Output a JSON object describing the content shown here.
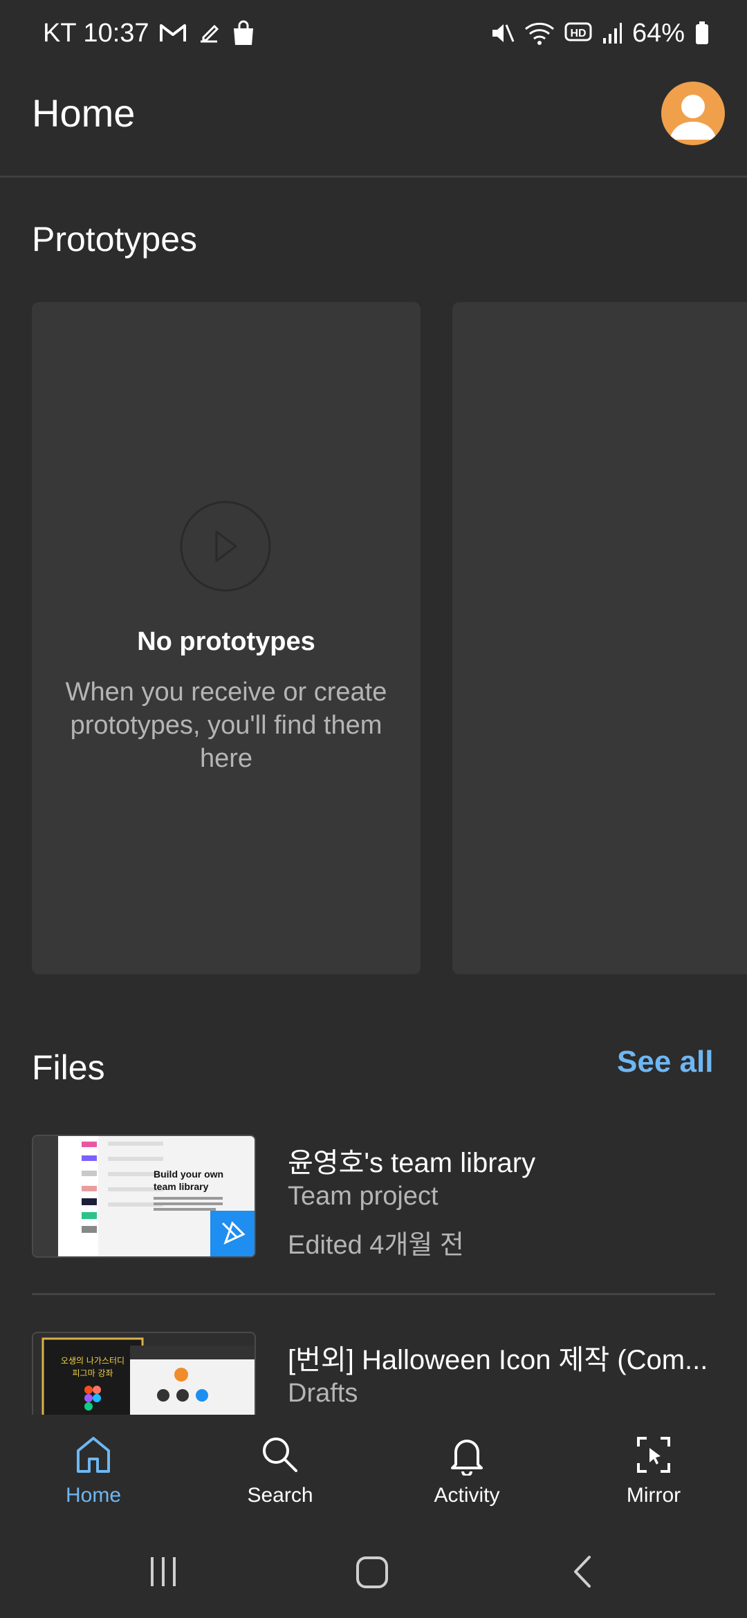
{
  "status_bar": {
    "carrier_time": "KT 10:37",
    "battery": "64%"
  },
  "header": {
    "title": "Home"
  },
  "prototypes": {
    "section_title": "Prototypes",
    "empty_title": "No prototypes",
    "empty_desc": "When you receive or create prototypes, you'll find them here"
  },
  "files": {
    "section_title": "Files",
    "see_all": "See all",
    "items": [
      {
        "name": "윤영호's team library",
        "type": "Team project",
        "edited": "Edited 4개월 전",
        "thumb_heading": "Build your own team library"
      },
      {
        "name": "[번외] Halloween Icon 제작 (Com...",
        "type": "Drafts",
        "thumb_heading": "오생의 나가스터디 피그마 강좌"
      }
    ]
  },
  "bottom_nav": [
    {
      "label": "Home",
      "icon": "home-icon",
      "active": true
    },
    {
      "label": "Search",
      "icon": "search-icon",
      "active": false
    },
    {
      "label": "Activity",
      "icon": "bell-icon",
      "active": false
    },
    {
      "label": "Mirror",
      "icon": "mirror-icon",
      "active": false
    }
  ],
  "colors": {
    "background": "#2c2c2c",
    "card": "#383838",
    "accent": "#6fb7f2",
    "avatar": "#f0a04b",
    "badge": "#1f8ef1"
  }
}
